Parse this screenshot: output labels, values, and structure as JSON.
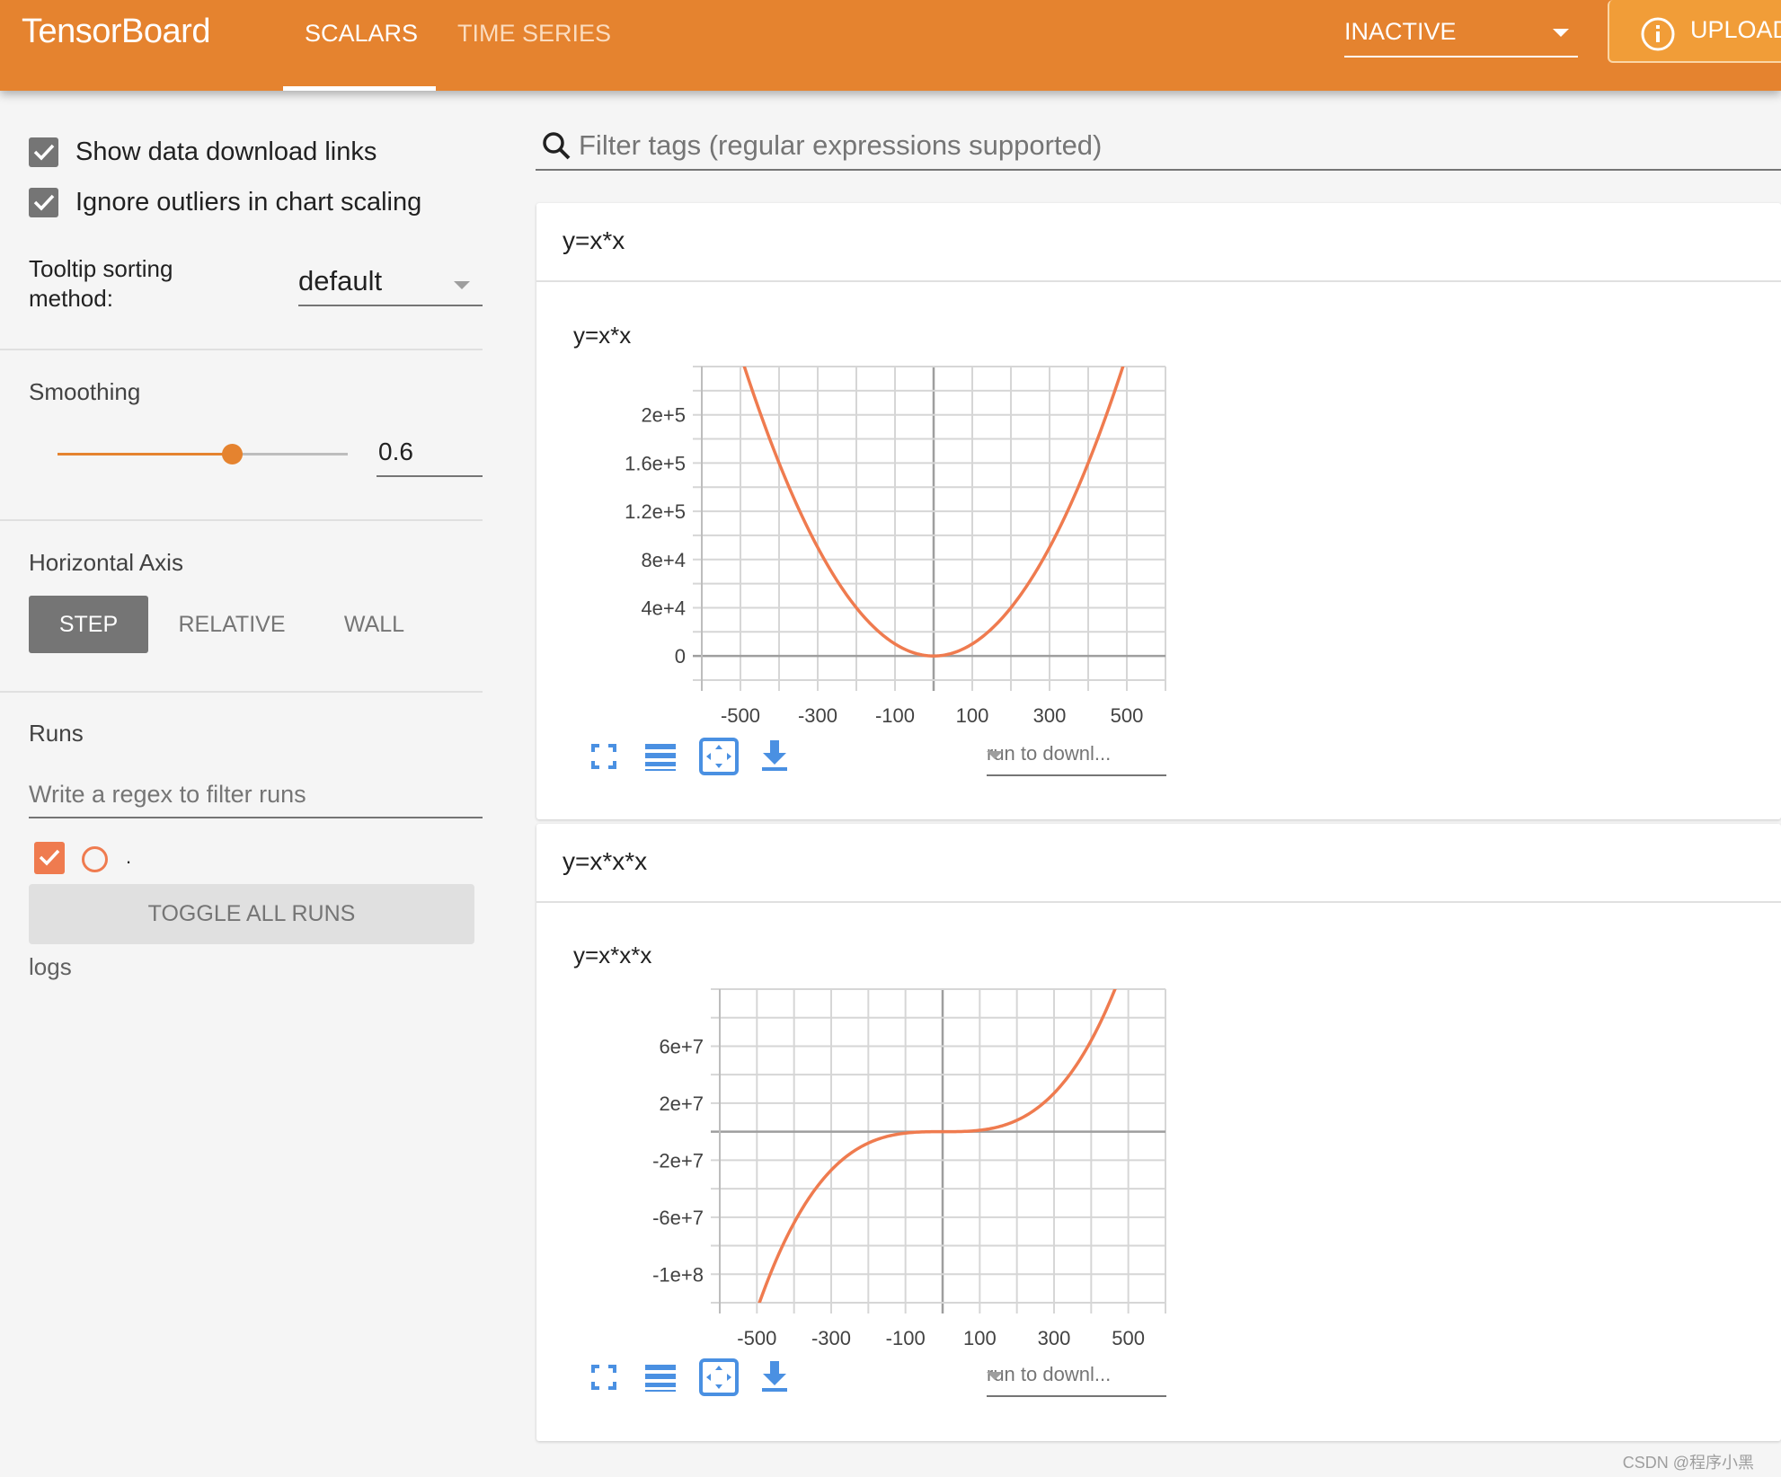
{
  "header": {
    "brand": "TensorBoard",
    "tabs": [
      {
        "label": "SCALARS",
        "active": true
      },
      {
        "label": "TIME SERIES",
        "active": false
      }
    ],
    "status_select": "INACTIVE",
    "upload_label": "UPLOAD",
    "colors": {
      "brand": "#e5832f",
      "upload": "#f19d38"
    }
  },
  "sidebar": {
    "options": [
      {
        "label": "Show data download links",
        "checked": true
      },
      {
        "label": "Ignore outliers in chart scaling",
        "checked": true
      }
    ],
    "tooltip_sorting": {
      "label_line1": "Tooltip sorting",
      "label_line2": "method:",
      "value": "default"
    },
    "smoothing": {
      "label": "Smoothing",
      "value": "0.6",
      "fraction": 0.6
    },
    "horizontal_axis": {
      "label": "Horizontal Axis",
      "buttons": [
        {
          "label": "STEP",
          "active": true
        },
        {
          "label": "RELATIVE",
          "active": false
        },
        {
          "label": "WALL",
          "active": false
        }
      ]
    },
    "runs": {
      "label": "Runs",
      "filter_placeholder": "Write a regex to filter runs",
      "items": [
        {
          "name": ".",
          "checked": true,
          "color": "#ef7b4f"
        }
      ],
      "toggle_label": "TOGGLE ALL RUNS",
      "logdir": "logs"
    }
  },
  "main": {
    "filter_placeholder": "Filter tags (regular expressions supported)",
    "cards": [
      {
        "tag": "y=x*x",
        "chart_title": "y=x*x",
        "run_select": "run to downl..."
      },
      {
        "tag": "y=x*x*x",
        "chart_title": "y=x*x*x",
        "run_select": "run to downl..."
      }
    ],
    "toolbar_icons": [
      "fullscreen-icon",
      "log-scale-icon",
      "fit-domain-icon",
      "download-icon"
    ]
  },
  "chart_data": [
    {
      "type": "line",
      "title": "y=x*x",
      "xlabel": "",
      "ylabel": "",
      "xlim": [
        -600,
        600
      ],
      "ylim": [
        -20000,
        240000
      ],
      "xticks": [
        -500,
        -300,
        -100,
        100,
        300,
        500
      ],
      "xtick_labels": [
        "-500",
        "-300",
        "-100",
        "100",
        "300",
        "500"
      ],
      "x_grid_step": 100,
      "yticks": [
        0,
        40000,
        80000,
        120000,
        160000,
        200000
      ],
      "ytick_labels": [
        "0",
        "4e+4",
        "8e+4",
        "1.2e+5",
        "1.6e+5",
        "2e+5"
      ],
      "y_grid_step": 20000,
      "grid": true,
      "series": [
        {
          "name": ".",
          "color": "#ef7b4f",
          "function": "x^2",
          "x_range": [
            -500,
            500
          ]
        }
      ]
    },
    {
      "type": "line",
      "title": "y=x*x*x",
      "xlabel": "",
      "ylabel": "",
      "xlim": [
        -600,
        600
      ],
      "ylim": [
        -120000000,
        100000000
      ],
      "xticks": [
        -500,
        -300,
        -100,
        100,
        300,
        500
      ],
      "xtick_labels": [
        "-500",
        "-300",
        "-100",
        "100",
        "300",
        "500"
      ],
      "x_grid_step": 100,
      "yticks": [
        60000000,
        20000000,
        -20000000,
        -60000000,
        -100000000
      ],
      "ytick_labels": [
        "6e+7",
        "2e+7",
        "-2e+7",
        "-6e+7",
        "-1e+8"
      ],
      "y_grid_step": 20000000,
      "grid": true,
      "series": [
        {
          "name": ".",
          "color": "#ef7b4f",
          "function": "x^3",
          "x_range": [
            -500,
            500
          ]
        }
      ]
    }
  ],
  "watermark": "CSDN @程序小黑"
}
